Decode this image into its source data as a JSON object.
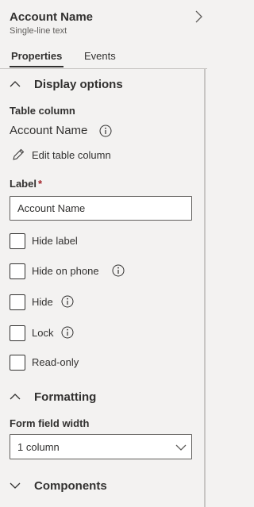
{
  "header": {
    "title": "Account Name",
    "subtitle": "Single-line text",
    "collapse_icon": "chevron-right-icon"
  },
  "tabs": [
    {
      "label": "Properties",
      "active": true
    },
    {
      "label": "Events",
      "active": false
    }
  ],
  "display_options": {
    "section_label": "Display options",
    "expanded": true,
    "table_column_label": "Table column",
    "table_column_value": "Account Name",
    "edit_link": "Edit table column",
    "label_field": {
      "label": "Label",
      "required_marker": "*",
      "value": "Account Name"
    },
    "checkboxes": [
      {
        "label": "Hide label",
        "checked": false,
        "info": false
      },
      {
        "label": "Hide on phone",
        "checked": false,
        "info": true
      },
      {
        "label": "Hide",
        "checked": false,
        "info": true
      },
      {
        "label": "Lock",
        "checked": false,
        "info": true
      },
      {
        "label": "Read-only",
        "checked": false,
        "info": false
      }
    ]
  },
  "formatting": {
    "section_label": "Formatting",
    "expanded": true,
    "form_field_width_label": "Form field width",
    "form_field_width_value": "1 column"
  },
  "components": {
    "section_label": "Components",
    "expanded": false
  },
  "colors": {
    "background": "#f3f2f1",
    "text": "#323130",
    "required": "#a4262c",
    "border": "#605e5c"
  }
}
